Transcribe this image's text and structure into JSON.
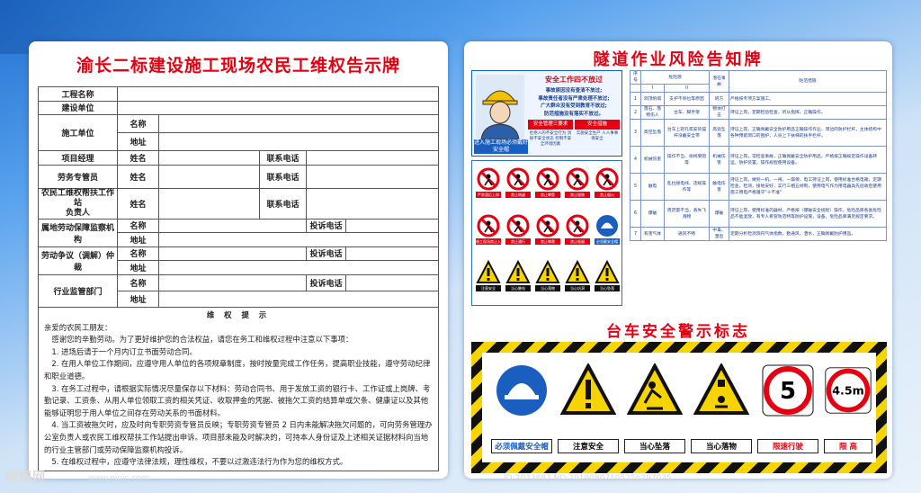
{
  "left_panel": {
    "title": "渝长二标建设施工现场农民工维权告示牌",
    "labels": {
      "project_name": "工程名称",
      "builder": "建设单位",
      "contractor": "施工单位",
      "name": "名称",
      "address": "地址",
      "project_manager": "项目经理",
      "person_name": "姓名",
      "phone": "联系电话",
      "labor_officer": "劳务专管员",
      "helper_line1": "农民工维权帮扶工作站",
      "helper_line2": "负责人",
      "labor_monitor": "属地劳动保障监察机构",
      "complaint_phone": "投诉电话",
      "arbitration": "劳动争议（调解）仲裁",
      "regulator": "行业监管部门"
    },
    "notice_heading": "维 权 提 示",
    "notice_lines": [
      "亲爱的农民工朋友：",
      "　感谢您的辛勤劳动。为了更好维护您的合法权益，请您在务工和维权过程中注意以下事项：",
      "　1. 进场后请于一个月内订立书面劳动合同。",
      "　2. 在用人单位工作期间，应遵守用人单位的各项规章制度，按时按量完成工作任务，提高职业技能，遵守劳动纪律和职业道德。",
      "　3. 在务工过程中，请根据实际情况尽量保存以下材料：劳动合同书、用于发放工资的银行卡、工作证或上岗牌、考勤记录、工资条、从用人单位领取工资的相关凭证、收取押金的凭据、被拖欠工资的结算单或欠条、健康证以及其他能够证明您于用人单位之间存在劳动关系的书面材料。",
      "　4. 当工资被拖欠时，应及时向专职劳资专管员反映；专职劳资专管员 2 日内未能解决拖欠问题的，可向劳务管理办公室负责人或农民工维权帮扶工作站提出申诉。项目部未能及时解决的，可持本人身份证及上述相关证据材料向当地的行业主管部门或劳动保障监察机构投诉。",
      "　5. 在维权过程中，应遵守法律法规，理性维权，不要以过激违法行为作为您的维权方式。"
    ]
  },
  "right_panel": {
    "title": "隧道作业风险告知牌",
    "safety_box": {
      "heading": "安全工作四不放过",
      "lines": [
        "事故原因没有查清不放过;",
        "事故责任者没有严肃处理不放过;",
        "广大群众没有受到教育不放过;",
        "防范措施没有落实不放过。"
      ],
      "btn_left": "安全管理三要求",
      "btn_right": "安全措施",
      "small_left": "杜绝人的不安全行为 消除不安全状态 控制不安全环境因素",
      "small_right": "实施安全生产 人人事事保安全",
      "worker_label": "进入施工现场必须戴好安全帽"
    },
    "prohibition_signs": [
      "严禁酒后上岗",
      "禁止跨越",
      "禁止攀登",
      "禁止抛物",
      "禁止烟火",
      "施工现场禁止入内",
      "禁止通行",
      "禁止攀爬",
      "禁止吸烟",
      "必须戴安全帽"
    ],
    "warning_signs": [
      "注意安全",
      "当心触电",
      "当心落物",
      "当心坑洞",
      "当心坠落"
    ],
    "risk_table": {
      "headers": [
        "序号",
        "危险源",
        "",
        "",
        "潜在事故",
        "防范措施"
      ],
      "subheaders": [
        "",
        "I",
        "II",
        "",
        "",
        ""
      ],
      "rows": [
        {
          "no": "1",
          "cat": "洞顶坍塌",
          "cause": "支护不到位等原因",
          "accident": "坍方",
          "measure": "严格按专项方案施工。"
        },
        {
          "no": "2",
          "cat": "落石、落物伤人",
          "cause": "台车、脚手架",
          "accident": "物体打击",
          "measure": "持证上岗，定期检验检查，听从指挥，正确操作。"
        },
        {
          "no": "3",
          "cat": "高空坠落",
          "cause": "台车上轻孔或安装锚杆没戴安全带",
          "accident": "高处坠落",
          "measure": "持证上岗，正确佩戴安全防护用品正确操作作业，洞边的防护栏杆，主体结构中各种预留洞口的围护，人员上下扶梯的扶手栏杆。"
        },
        {
          "no": "4",
          "cat": "机械伤害",
          "cause": "操作不当、视线受阻等",
          "accident": "机械伤害",
          "measure": "持证上岗，常检查事故，正确佩戴安全防护用品，严格按正确规定操作设备转运，防护装置，操作规程使用设备。"
        },
        {
          "no": "5",
          "cat": "触电",
          "cause": "乱拉接电线、违规操作等",
          "accident": "触电伤害",
          "measure": "持证上岗，做到一机、一闸、一漏保，电工持证上岗，使用标准合格电箱，定期检查，检测，接地安好，实行三相五线制，使用电气作为用电器具先验收后使用施工用电严格遵守\"十不准\""
        },
        {
          "no": "6",
          "cat": "爆破",
          "cause": "周药量不当，丢失飞溅物",
          "accident": "爆破",
          "measure": "持证上岗，使用标准的器材，严格按（爆破安全规程）操作，危险品库各类危险品不能混放，有专人看管防范特等防护设施，设备，危险品库满足规定要求。"
        },
        {
          "no": "7",
          "cat": "有害气体",
          "cause": "通风不畅",
          "accident": "中毒、窒息",
          "measure": "定期分析检测洞内气体指数，勤通风，洒水，正确佩戴防护用品。"
        }
      ]
    },
    "subtitle": "台车安全警示标志",
    "warning_board": [
      {
        "label": "必须佩戴安全帽",
        "style": "blue"
      },
      {
        "label": "注意安全",
        "style": "yellow"
      },
      {
        "label": "当心坠落",
        "style": "yellow"
      },
      {
        "label": "当心落物",
        "style": "yellow"
      },
      {
        "label": "限速行驶",
        "style": "red",
        "value": "5"
      },
      {
        "label": "限 高",
        "style": "red",
        "value": "4.5m"
      }
    ]
  },
  "watermark": {
    "logo": "昵图网",
    "site": "www.nipic.com",
    "id": "ID:2033883 NO:20190807105256297035"
  },
  "colors": {
    "accent_red": "#e60012",
    "navy": "#1a3e8c",
    "blue": "#1a5fc0",
    "hazard_yellow": "#f5d400"
  }
}
